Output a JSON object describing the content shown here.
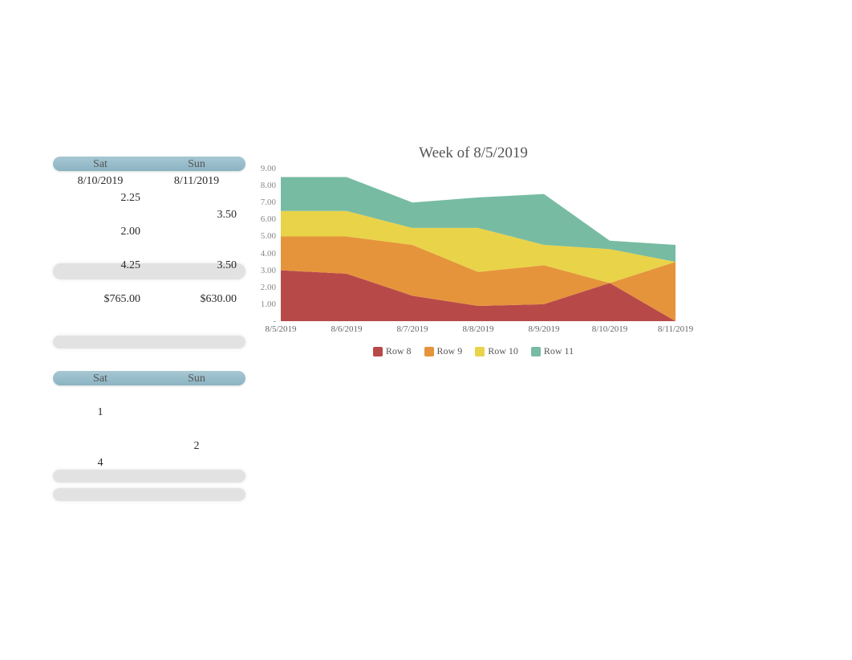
{
  "tables": {
    "t1": {
      "headers": [
        "Sat",
        "Sun"
      ],
      "rows": [
        [
          "8/10/2019",
          "8/11/2019"
        ],
        [
          "2.25",
          ""
        ],
        [
          "",
          "3.50"
        ],
        [
          "2.00",
          ""
        ],
        [
          "",
          ""
        ],
        [
          "4.25",
          "3.50"
        ],
        [
          "",
          ""
        ],
        [
          "$765.00",
          "$630.00"
        ],
        [
          "",
          ""
        ],
        [
          "",
          ""
        ]
      ],
      "dateRowCenter": true
    },
    "t2": {
      "headers": [
        "Sat",
        "Sun"
      ],
      "rows": [
        [
          "",
          ""
        ],
        [
          "1",
          ""
        ],
        [
          "",
          ""
        ],
        [
          "",
          "2"
        ],
        [
          "4",
          ""
        ],
        [
          "",
          ""
        ],
        [
          "",
          ""
        ]
      ]
    }
  },
  "chart_data": {
    "type": "area",
    "stacked": true,
    "title": "Week of 8/5/2019",
    "xlabel": "",
    "ylabel": "",
    "ylim": [
      0,
      9
    ],
    "yticks_text": [
      "9.00",
      "8.00",
      "7.00",
      "6.00",
      "5.00",
      "4.00",
      "3.00",
      "2.00",
      "1.00",
      "-"
    ],
    "categories": [
      "8/5/2019",
      "8/6/2019",
      "8/7/2019",
      "8/8/2019",
      "8/9/2019",
      "8/10/2019",
      "8/11/2019"
    ],
    "series": [
      {
        "name": "Row 8",
        "color": "#b23a3a",
        "values": [
          3.0,
          2.8,
          1.5,
          0.9,
          1.0,
          2.25,
          0.0
        ]
      },
      {
        "name": "Row 9",
        "color": "#e38b2b",
        "values": [
          2.0,
          2.2,
          3.0,
          2.0,
          2.3,
          0.0,
          3.5
        ]
      },
      {
        "name": "Row 10",
        "color": "#e7cf3a",
        "values": [
          1.5,
          1.5,
          1.0,
          2.6,
          1.2,
          2.0,
          0.0
        ]
      },
      {
        "name": "Row 11",
        "color": "#6bb59b",
        "values": [
          2.0,
          2.0,
          1.5,
          1.8,
          3.0,
          0.5,
          1.0
        ]
      }
    ],
    "legend_position": "bottom",
    "grid": false
  }
}
